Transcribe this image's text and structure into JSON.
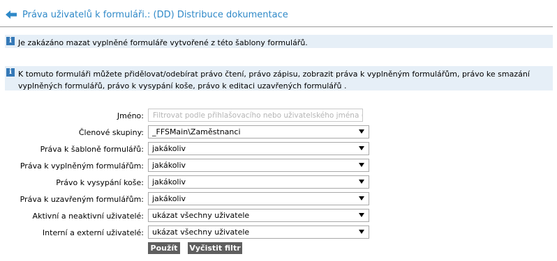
{
  "header": {
    "title": "Práva uživatelů k formuláři.: (DD) Distribuce dokumentace",
    "back_icon": "arrow-left-icon",
    "accent_color": "#2f89c8"
  },
  "notices": [
    {
      "icon": "info-icon",
      "text": "Je zakázáno mazat vyplněné formuláře vytvořené z této šablony formulářů."
    },
    {
      "icon": "info-icon",
      "line1": "K tomuto formuláři můžete přidělovat/odebírat právo čtení, právo zápisu, zobrazit práva k vyplněným formulářům, právo ke smazání",
      "line2": "vyplněných formulářů, právo k vysypání koše, právo k editaci uzavřených formulářů ."
    }
  ],
  "filter": {
    "name": {
      "label": "Jméno:",
      "placeholder": "Filtrovat podle přihlašovacího nebo uživatelského jména (po"
    },
    "groups": {
      "label": "Členové skupiny:",
      "value": "_FFSMain\\Zaměstnanci"
    },
    "template_rights": {
      "label": "Práva k šabloně formulářů:",
      "value": "jakákoliv"
    },
    "filled_rights": {
      "label": "Práva k vyplněným formulářům:",
      "value": "jakákoliv"
    },
    "trash_right": {
      "label": "Právo k vysypání koše:",
      "value": "jakákoliv"
    },
    "closed_rights": {
      "label": "Práva k uzavřeným formulářům:",
      "value": "jakákoliv"
    },
    "active_users": {
      "label": "Aktivní a neaktivní uživatelé:",
      "value": "ukázat všechny uživatele"
    },
    "internal_users": {
      "label": "Interní a externí uživatelé:",
      "value": "ukázat všechny uživatele"
    }
  },
  "buttons": {
    "apply": "Použít",
    "clear": "Vyčistit filtr"
  }
}
